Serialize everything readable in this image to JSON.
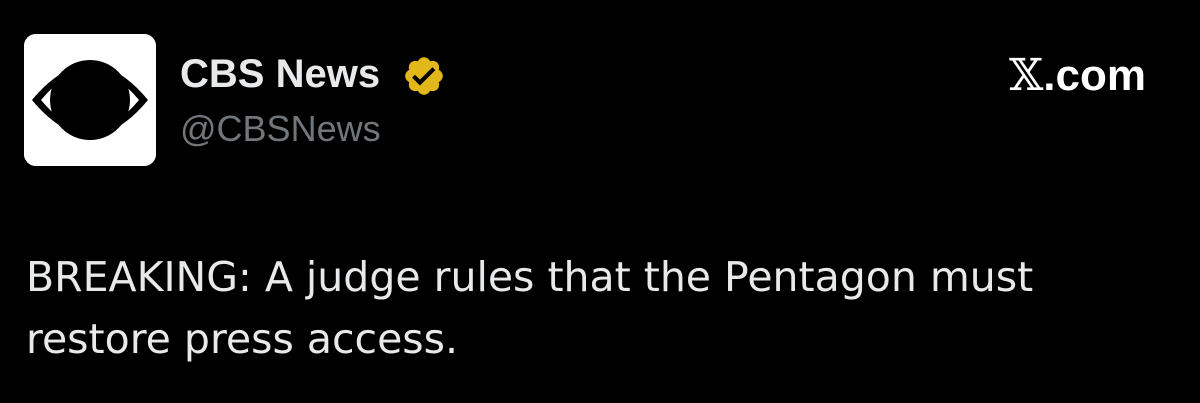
{
  "account": {
    "display_name": "CBS News",
    "handle": "@CBSNews",
    "verified_icon": "verified-gold-badge-icon",
    "avatar_icon": "cbs-eye-logo-icon"
  },
  "source": {
    "logo_glyph": "𝕏",
    "suffix": ".com"
  },
  "tweet": {
    "text": "BREAKING: A judge rules that the Pentagon must restore press access."
  },
  "colors": {
    "background": "#000000",
    "text": "#e7e9ea",
    "handle": "#71767b",
    "badge_gold": "#e2b719"
  }
}
